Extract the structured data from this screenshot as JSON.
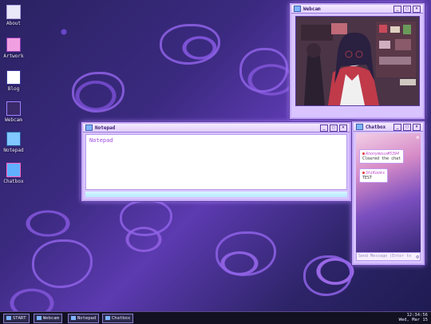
{
  "desktop": {
    "icons": [
      {
        "label": "About",
        "icon": "document-icon"
      },
      {
        "label": "Artwork",
        "icon": "artwork-icon"
      },
      {
        "label": "Blog",
        "icon": "blog-icon"
      },
      {
        "label": "Webcam",
        "icon": "webcam-icon"
      },
      {
        "label": "Notepad",
        "icon": "notepad-icon"
      },
      {
        "label": "Chatbox",
        "icon": "chatbox-icon"
      }
    ]
  },
  "webcam_window": {
    "title": "Webcam"
  },
  "notepad_window": {
    "title": "Notepad",
    "content": "Notepad"
  },
  "chatbox_window": {
    "title": "Chatbox",
    "messages": [
      {
        "user": "Anonymous#5394",
        "text": "Cleared the chat"
      },
      {
        "user": "ShiKooks",
        "text": "TEST"
      }
    ],
    "input_placeholder": "Send Message (Enter to"
  },
  "window_controls": {
    "minimize": "_",
    "maximize": "□",
    "close": "×"
  },
  "taskbar": {
    "start_label": "START",
    "items": [
      "Webcam",
      "Notepad",
      "Chatbox"
    ],
    "time": "12:34:56",
    "date": "Wed, Mar 15"
  },
  "colors": {
    "accent": "#9c4ae0",
    "window": "#d9c4ff",
    "taskbar": "#111122"
  }
}
